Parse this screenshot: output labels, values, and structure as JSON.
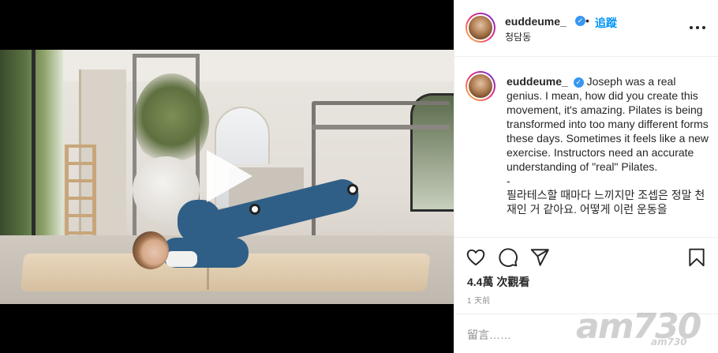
{
  "post": {
    "username": "euddeume_",
    "verified_mark": "✓",
    "separator": "•",
    "follow_label": "追蹤",
    "location": "청담동",
    "caption_text": "Joseph was a real genius. I mean, how did you create this movement, it's amazing. Pilates is being transformed into too many different forms these days. Sometimes it feels like a new exercise. Instructors need an accurate understanding of \"real\" Pilates.",
    "caption_divider": "-",
    "caption_korean": "필라테스할 때마다 느끼지만 조셉은 정말 천재인 거 같아요. 어떻게 이런 운동을",
    "views": "4.4萬 次觀看",
    "time": "1 天前",
    "comment_placeholder": "留言……"
  },
  "icons": {
    "more": "more-horizontal-icon",
    "like": "heart-icon",
    "comment": "comment-icon",
    "share": "share-icon",
    "save": "bookmark-icon",
    "play": "play-icon"
  },
  "watermark": {
    "text": "am730",
    "sub": "am730"
  },
  "colors": {
    "link_blue": "#0095f6",
    "verified_blue": "#3897f0",
    "text": "#262626",
    "muted": "#8e8e8e"
  }
}
